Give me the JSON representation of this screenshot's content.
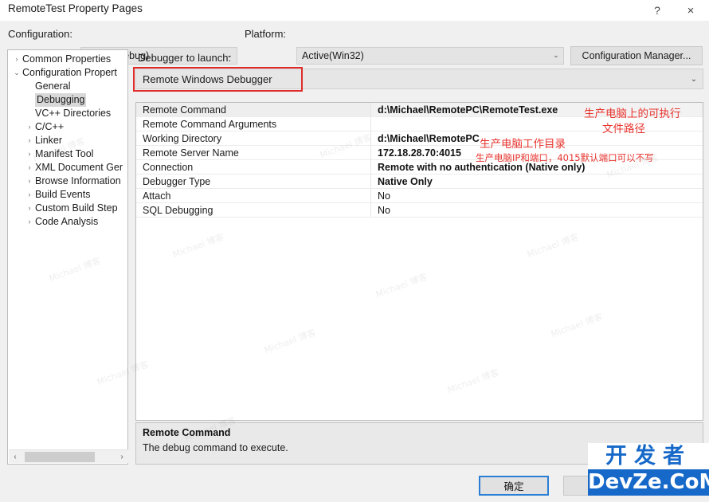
{
  "window": {
    "title": "RemoteTest Property Pages",
    "help_icon": "?",
    "close_icon": "×"
  },
  "config_bar": {
    "configuration_label": "Configuration:",
    "configuration_value": "Active(Debug)",
    "platform_label": "Platform:",
    "platform_value": "Active(Win32)",
    "configuration_manager_button": "Configuration Manager...",
    "chevron": "⌄"
  },
  "tree": {
    "items": [
      {
        "label": "Common Properties",
        "level": 0,
        "twisty": "›",
        "selected": false
      },
      {
        "label": "Configuration Propert",
        "level": 0,
        "twisty": "⌄",
        "selected": false
      },
      {
        "label": "General",
        "level": 1,
        "twisty": "",
        "selected": false
      },
      {
        "label": "Debugging",
        "level": 1,
        "twisty": "",
        "selected": true
      },
      {
        "label": "VC++ Directories",
        "level": 1,
        "twisty": "",
        "selected": false
      },
      {
        "label": "C/C++",
        "level": 1,
        "twisty": "›",
        "selected": false
      },
      {
        "label": "Linker",
        "level": 1,
        "twisty": "›",
        "selected": false
      },
      {
        "label": "Manifest Tool",
        "level": 1,
        "twisty": "›",
        "selected": false
      },
      {
        "label": "XML Document Ger",
        "level": 1,
        "twisty": "›",
        "selected": false
      },
      {
        "label": "Browse Information",
        "level": 1,
        "twisty": "›",
        "selected": false
      },
      {
        "label": "Build Events",
        "level": 1,
        "twisty": "›",
        "selected": false
      },
      {
        "label": "Custom Build Step",
        "level": 1,
        "twisty": "›",
        "selected": false
      },
      {
        "label": "Code Analysis",
        "level": 1,
        "twisty": "›",
        "selected": false
      }
    ],
    "scroll_left_arrow": "‹",
    "scroll_right_arrow": "›"
  },
  "debugger": {
    "label": "Debugger to launch:",
    "value": "Remote Windows Debugger",
    "chevron": "⌄",
    "highlight_color": "#e02b2b"
  },
  "grid": {
    "rows": [
      {
        "name": "Remote Command",
        "value": "d:\\Michael\\RemotePC\\RemoteTest.exe",
        "bold": true,
        "selected": true
      },
      {
        "name": "Remote Command Arguments",
        "value": "",
        "bold": false,
        "selected": false
      },
      {
        "name": "Working Directory",
        "value": "d:\\Michael\\RemotePC",
        "bold": true,
        "selected": false
      },
      {
        "name": "Remote Server Name",
        "value": "172.18.28.70:4015",
        "bold": true,
        "selected": false
      },
      {
        "name": "Connection",
        "value": "Remote with no authentication (Native only)",
        "bold": true,
        "selected": false
      },
      {
        "name": "Debugger Type",
        "value": "Native Only",
        "bold": true,
        "selected": false
      },
      {
        "name": "Attach",
        "value": "No",
        "bold": false,
        "selected": false
      },
      {
        "name": "SQL Debugging",
        "value": "No",
        "bold": false,
        "selected": false
      }
    ]
  },
  "annotations": {
    "exe_line1": "生产电脑上的可执行",
    "exe_line2": "文件路径",
    "working_dir": "生产电脑工作目录",
    "server": "生产电脑IP和端口，4015默认端口可以不写",
    "color": "#e8352f"
  },
  "description": {
    "title": "Remote Command",
    "body": "The debug command to execute."
  },
  "footer": {
    "ok_label": "确定",
    "cancel_label": "",
    "focus_color": "#2a7fd4"
  },
  "watermark": {
    "logo_top": "开发者",
    "logo_bottom": "DevZe.CoM",
    "tiles": [
      "Michael 博客",
      "Michael 博客",
      "Michael 博客",
      "Michael 博客",
      "Michael 博客",
      "Michael 博客",
      "Michael 博客",
      "Michael 博客",
      "Michael 博客",
      "Michael 博客",
      "Michael 博客",
      "Michael 博客"
    ],
    "color": "#787878"
  }
}
